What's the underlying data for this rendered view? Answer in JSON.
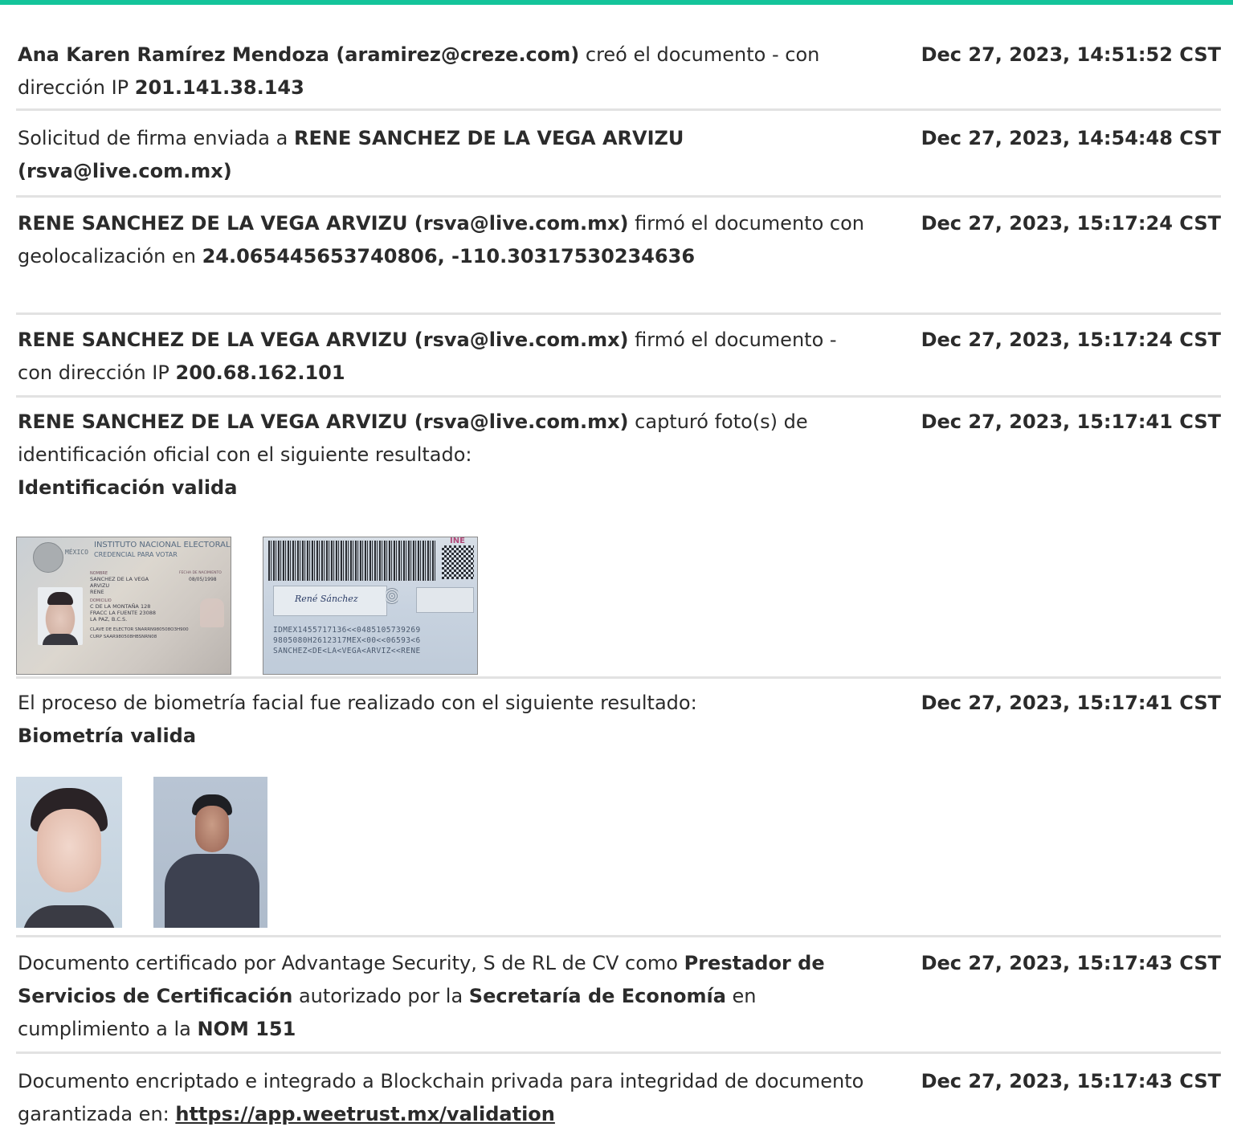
{
  "accent_color": "#14c49a",
  "entries": [
    {
      "actor": "Ana Karen Ramírez Mendoza (aramirez@creze.com)",
      "text1": " creó el documento - con dirección IP ",
      "ip": "201.141.38.143",
      "time": "Dec 27, 2023, 14:51:52 CST"
    },
    {
      "text1": "Solicitud de firma enviada a ",
      "actor": "RENE SANCHEZ DE LA VEGA ARVIZU (rsva@live.com.mx)",
      "time": "Dec 27, 2023, 14:54:48 CST"
    },
    {
      "actor": "RENE SANCHEZ DE LA VEGA ARVIZU (rsva@live.com.mx)",
      "text1": " firmó el documento con geolocalización en ",
      "geo": "24.065445653740806, -110.30317530234636",
      "time": "Dec 27, 2023, 15:17:24 CST"
    },
    {
      "actor": "RENE SANCHEZ DE LA VEGA ARVIZU (rsva@live.com.mx)",
      "text1": " firmó el documento - con dirección IP ",
      "ip": "200.68.162.101",
      "time": "Dec 27, 2023, 15:17:24 CST"
    },
    {
      "actor": "RENE SANCHEZ DE LA VEGA ARVIZU (rsva@live.com.mx)",
      "text1": " capturó foto(s) de identificación oficial con el siguiente resultado:",
      "result": "Identificación valida",
      "time": "Dec 27, 2023, 15:17:41 CST",
      "id_front": {
        "header1": "INSTITUTO NACIONAL ELECTORAL",
        "header2": "CREDENCIAL PARA VOTAR",
        "country": "MÉXICO",
        "name_label": "NOMBRE",
        "name_lines": [
          "SANCHEZ DE LA VEGA",
          "ARVIZU",
          "RENE"
        ],
        "address_label": "DOMICILIO",
        "address_lines": [
          "C DE LA MONTAÑA 128",
          "FRACC LA FUENTE 23088",
          "LA PAZ, B.C.S."
        ],
        "clave": "CLAVE DE ELECTOR SNARRN980508O3H900",
        "curp": "CURP SAAR980508HBSNRN08",
        "birth_label": "FECHA DE NACIMIENTO",
        "birth": "08/05/1998"
      },
      "id_back": {
        "brand": "INE",
        "signature": "René Sánchez",
        "mrz": [
          "IDMEX1455717136<<0485105739269",
          "9805080H2612317MEX<00<<06593<6",
          "SANCHEZ<DE<LA<VEGA<ARVIZ<<RENE"
        ]
      }
    },
    {
      "text1": "El proceso de biometría facial fue realizado con el siguiente resultado:",
      "result": "Biometría valida",
      "time": "Dec 27, 2023, 15:17:41 CST"
    },
    {
      "text1": "Documento certificado por Advantage Security, S de RL de CV como ",
      "b1": "Prestador de Servicios de Certificación",
      "text2": " autorizado por la ",
      "b2": "Secretaría de Economía",
      "text3": " en cumplimiento a la ",
      "b3": "NOM 151",
      "time": "Dec 27, 2023, 15:17:43 CST"
    },
    {
      "text1": "Documento encriptado e integrado a Blockchain privada para integridad de documento garantizada en: ",
      "link": "https://app.weetrust.mx/validation",
      "time": "Dec 27, 2023, 15:17:43 CST"
    }
  ]
}
